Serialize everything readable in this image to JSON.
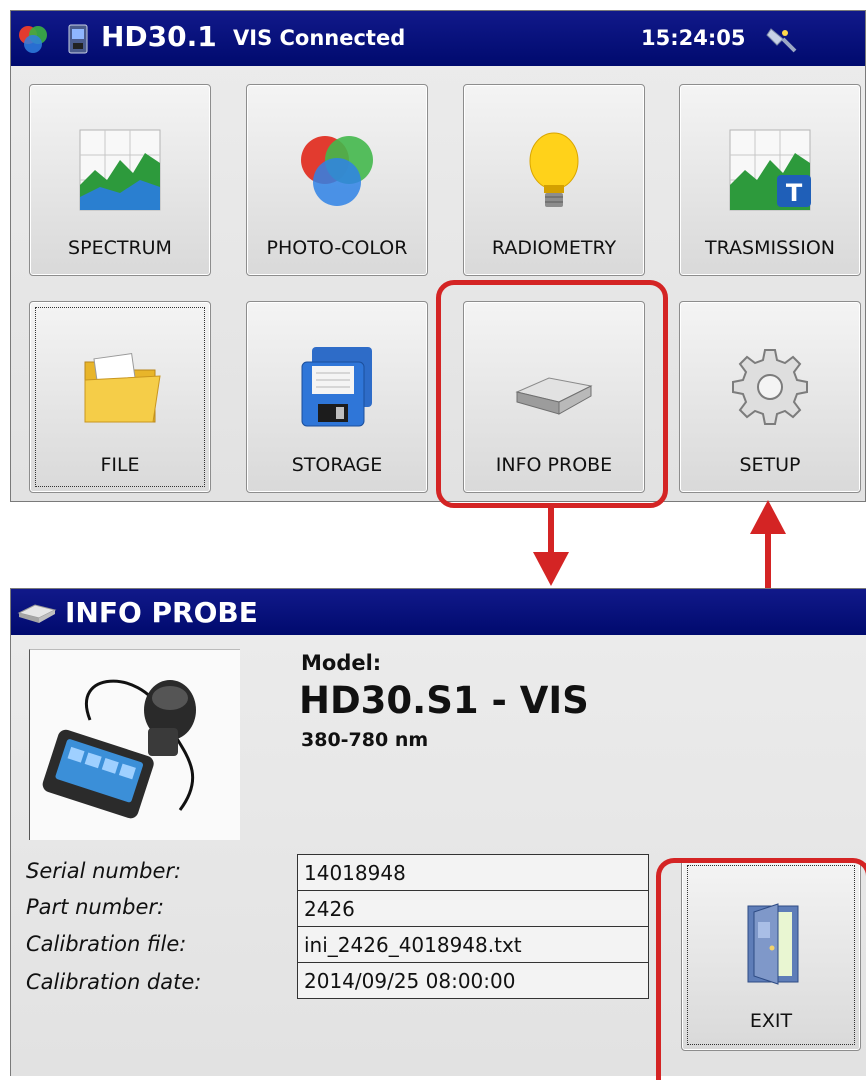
{
  "top_screen": {
    "app_title": "HD30.1",
    "connection_status": "VIS Connected",
    "clock": "15:24:05",
    "tiles": [
      {
        "label": "SPECTRUM",
        "icon": "spectrum-chart-icon"
      },
      {
        "label": "PHOTO-COLOR",
        "icon": "color-circles-icon"
      },
      {
        "label": "RADIOMETRY",
        "icon": "light-bulb-icon"
      },
      {
        "label": "TRASMISSION",
        "icon": "transmission-chart-icon"
      },
      {
        "label": "FILE",
        "icon": "folder-icon"
      },
      {
        "label": "STORAGE",
        "icon": "floppy-disk-icon"
      },
      {
        "label": "INFO PROBE",
        "icon": "probe-device-icon"
      },
      {
        "label": "SETUP",
        "icon": "gear-icon"
      }
    ]
  },
  "info_screen": {
    "title": "INFO PROBE",
    "model_label": "Model:",
    "model_name": "HD30.S1 - VIS",
    "wavelength_range": "380-780 nm",
    "fields": [
      {
        "label": "Serial number:",
        "value": "14018948"
      },
      {
        "label": "Part number:",
        "value": "2426"
      },
      {
        "label": "Calibration file:",
        "value": "ini_2426_4018948.txt"
      },
      {
        "label": "Calibration date:",
        "value": "2014/09/25 08:00:00"
      }
    ],
    "exit_label": "EXIT"
  },
  "colors": {
    "title_bar": "#0a1280",
    "highlight": "#d42424"
  }
}
